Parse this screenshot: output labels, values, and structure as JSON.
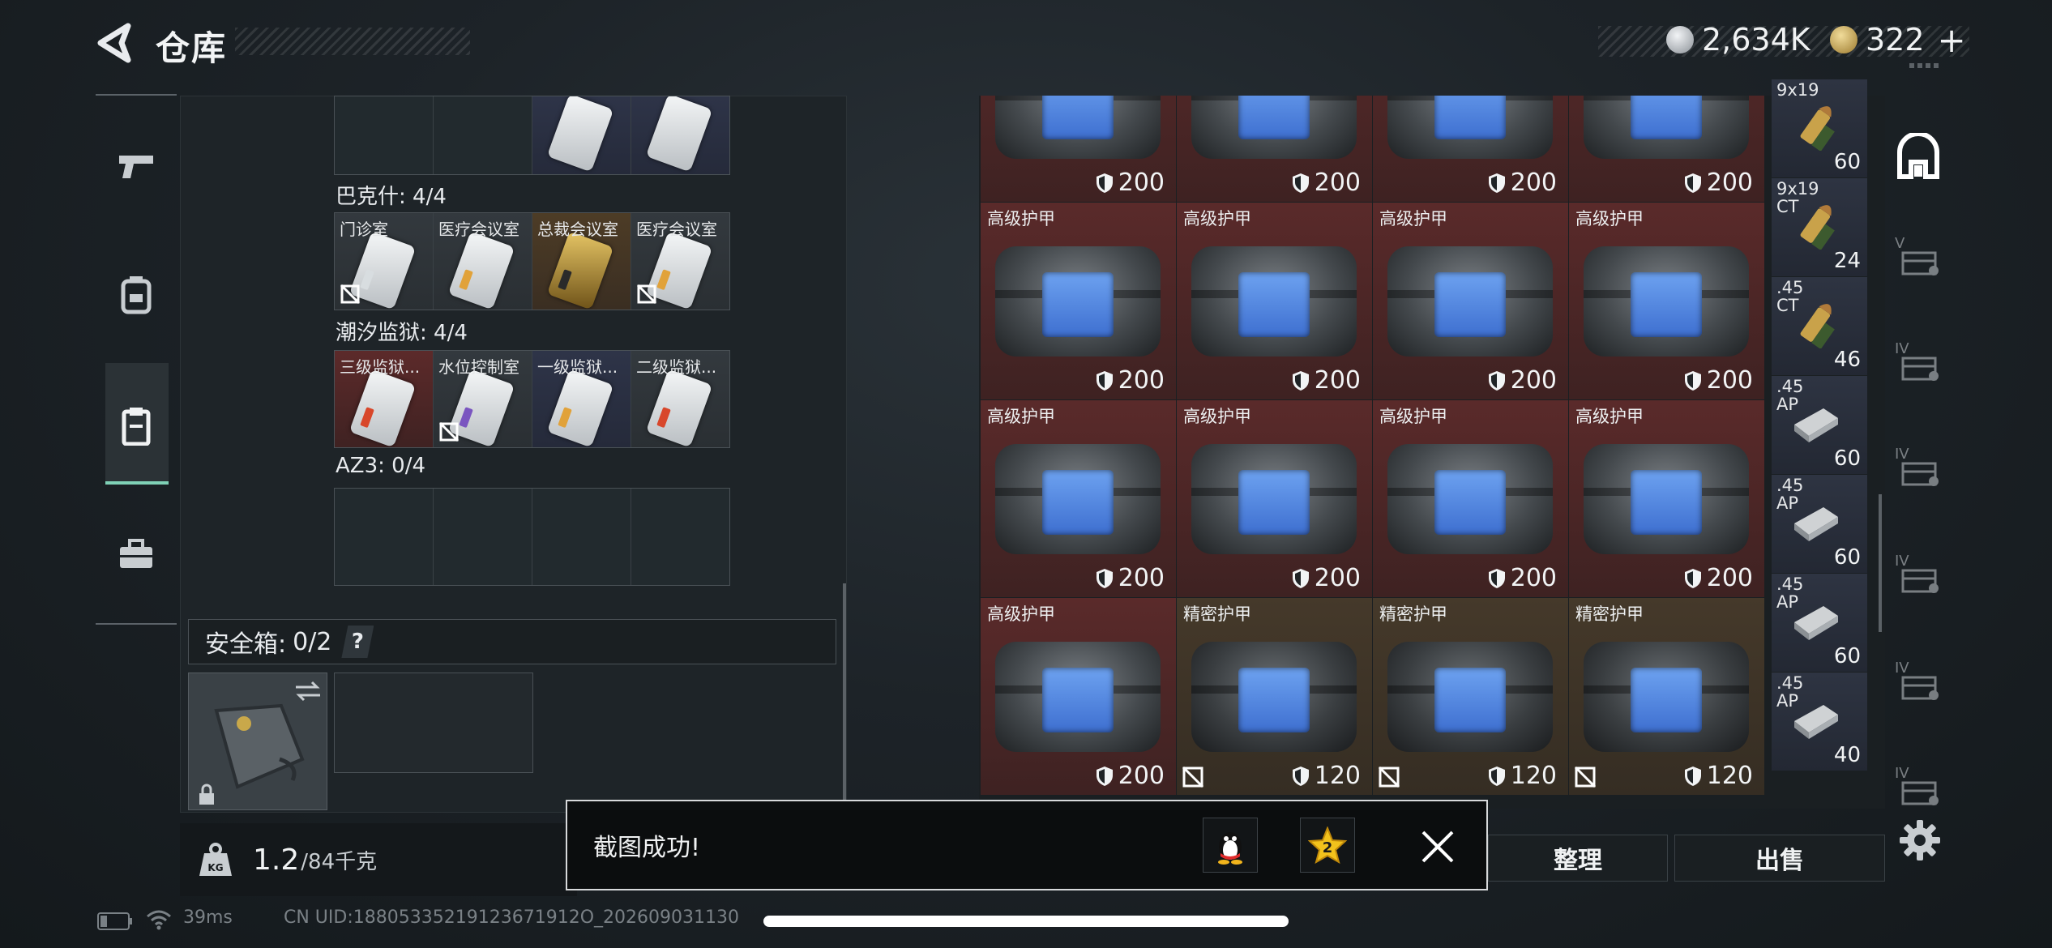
{
  "header": {
    "title": "仓库",
    "currency": [
      {
        "icon": "silver-coin-icon",
        "amount": "2,634K"
      },
      {
        "icon": "gold-coin-icon",
        "amount": "322"
      }
    ],
    "add_label": "+"
  },
  "left": {
    "top_row": [
      {
        "type": "empty"
      },
      {
        "type": "empty"
      },
      {
        "type": "card"
      },
      {
        "type": "card"
      }
    ],
    "sections": [
      {
        "label": "巴克什: 4/4",
        "cells": [
          {
            "name": "门诊室",
            "color": "grey",
            "locked": true
          },
          {
            "name": "医疗会议室",
            "color": "grey",
            "locked": false
          },
          {
            "name": "总裁会议室",
            "color": "gold",
            "locked": false
          },
          {
            "name": "医疗会议室",
            "color": "grey",
            "locked": true
          }
        ]
      },
      {
        "label": "潮汐监狱: 4/4",
        "cells": [
          {
            "name": "三级监狱...",
            "color": "red",
            "locked": false
          },
          {
            "name": "水位控制室",
            "color": "grey",
            "locked": true
          },
          {
            "name": "一级监狱...",
            "color": "blue",
            "locked": false
          },
          {
            "name": "二级监狱...",
            "color": "grey",
            "locked": false
          }
        ]
      },
      {
        "label": "AZ3: 0/4",
        "cells": [
          {},
          {},
          {},
          {}
        ]
      }
    ],
    "safe_box": {
      "label": "安全箱:",
      "count": "0/2",
      "help": "?"
    },
    "weight": {
      "value": "1.2",
      "max": "/84千克",
      "icon_text": "KG"
    }
  },
  "armor_grid": {
    "rows": [
      [
        {
          "name": "",
          "value": "200",
          "type": "hi"
        },
        {
          "name": "",
          "value": "200",
          "type": "hi"
        },
        {
          "name": "",
          "value": "200",
          "type": "hi"
        },
        {
          "name": "",
          "value": "200",
          "type": "hi"
        }
      ],
      [
        {
          "name": "高级护甲",
          "value": "200",
          "type": "hi"
        },
        {
          "name": "高级护甲",
          "value": "200",
          "type": "hi"
        },
        {
          "name": "高级护甲",
          "value": "200",
          "type": "hi"
        },
        {
          "name": "高级护甲",
          "value": "200",
          "type": "hi"
        }
      ],
      [
        {
          "name": "高级护甲",
          "value": "200",
          "type": "hi"
        },
        {
          "name": "高级护甲",
          "value": "200",
          "type": "hi"
        },
        {
          "name": "高级护甲",
          "value": "200",
          "type": "hi"
        },
        {
          "name": "高级护甲",
          "value": "200",
          "type": "hi"
        }
      ],
      [
        {
          "name": "高级护甲",
          "value": "200",
          "type": "hi"
        },
        {
          "name": "精密护甲",
          "value": "120",
          "type": "pr"
        },
        {
          "name": "精密护甲",
          "value": "120",
          "type": "pr"
        },
        {
          "name": "精密护甲",
          "value": "120",
          "type": "pr"
        }
      ]
    ]
  },
  "ammo": [
    {
      "name": "9x19",
      "sub": "",
      "count": "60",
      "kind": "brass"
    },
    {
      "name": "9x19",
      "sub": "CT",
      "count": "24",
      "kind": "brass"
    },
    {
      "name": ".45",
      "sub": "CT",
      "count": "46",
      "kind": "brass"
    },
    {
      "name": ".45",
      "sub": "AP",
      "count": "60",
      "kind": "box"
    },
    {
      "name": ".45",
      "sub": "AP",
      "count": "60",
      "kind": "box"
    },
    {
      "name": ".45",
      "sub": "AP",
      "count": "60",
      "kind": "box"
    },
    {
      "name": ".45",
      "sub": "AP",
      "count": "40",
      "kind": "box"
    }
  ],
  "right_tabs": [
    "V",
    "IV",
    "IV",
    "IV",
    "IV",
    "IV"
  ],
  "buttons": {
    "sort": "整理",
    "sell": "出售"
  },
  "toast": {
    "text": "截图成功!",
    "badge": "2"
  },
  "status": {
    "ping": "39ms",
    "uid": "CN UID:18805335219123671912O_202609031130"
  },
  "colors": {
    "accent": "#7fd1b6",
    "high_armor": "#5a2a2a",
    "precise_armor": "#45392a",
    "ammo": "#2e3442"
  }
}
